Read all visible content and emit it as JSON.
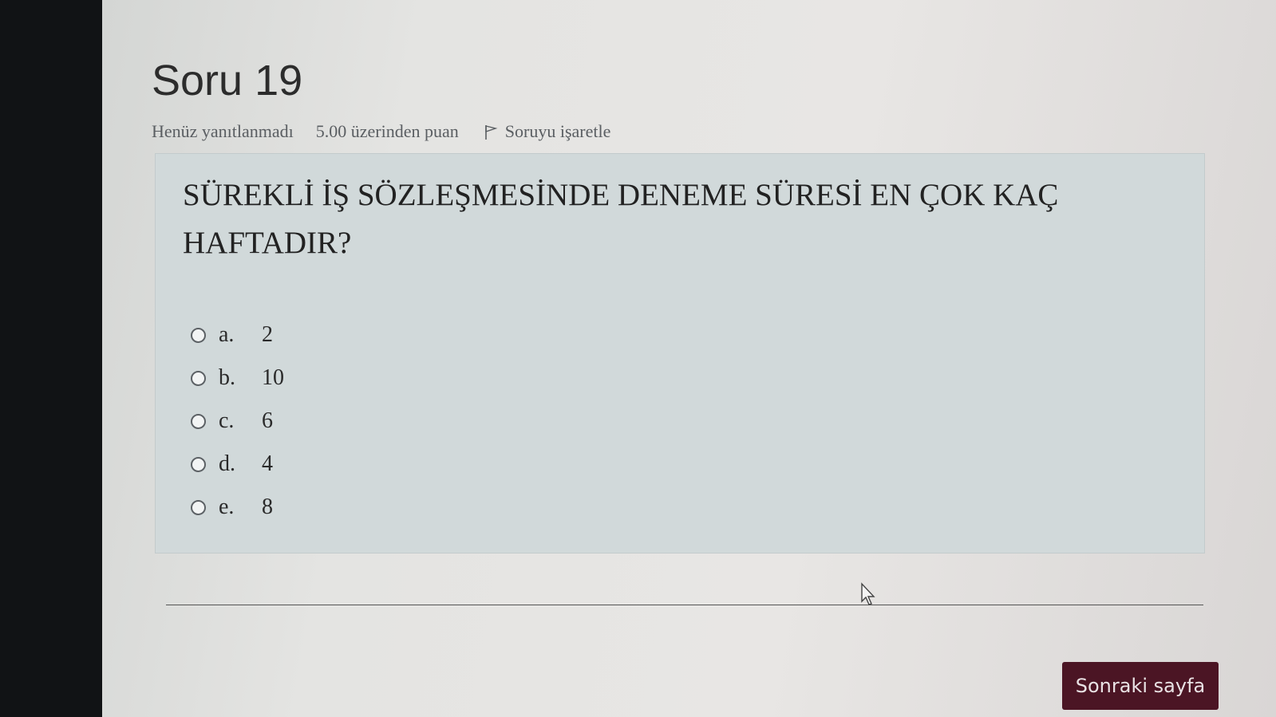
{
  "question": {
    "title": "Soru 19",
    "status": "Henüz yanıtlanmadı",
    "grade": "5.00 üzerinden puan",
    "flag_label": "Soruyu işaretle",
    "text": "SÜREKLİ İŞ SÖZLEŞMESİNDE DENEME SÜRESİ EN ÇOK KAÇ HAFTADIR?",
    "answers": [
      {
        "letter": "a.",
        "value": "2"
      },
      {
        "letter": "b.",
        "value": "10"
      },
      {
        "letter": "c.",
        "value": "6"
      },
      {
        "letter": "d.",
        "value": "4"
      },
      {
        "letter": "e.",
        "value": "8"
      }
    ]
  },
  "navigation": {
    "next_label": "Sonraki sayfa"
  },
  "icons": {
    "flag": "flag-icon",
    "cursor": "mouse-pointer-icon"
  },
  "colors": {
    "next_button": "#4b1524",
    "question_box": "#d1d9da"
  }
}
